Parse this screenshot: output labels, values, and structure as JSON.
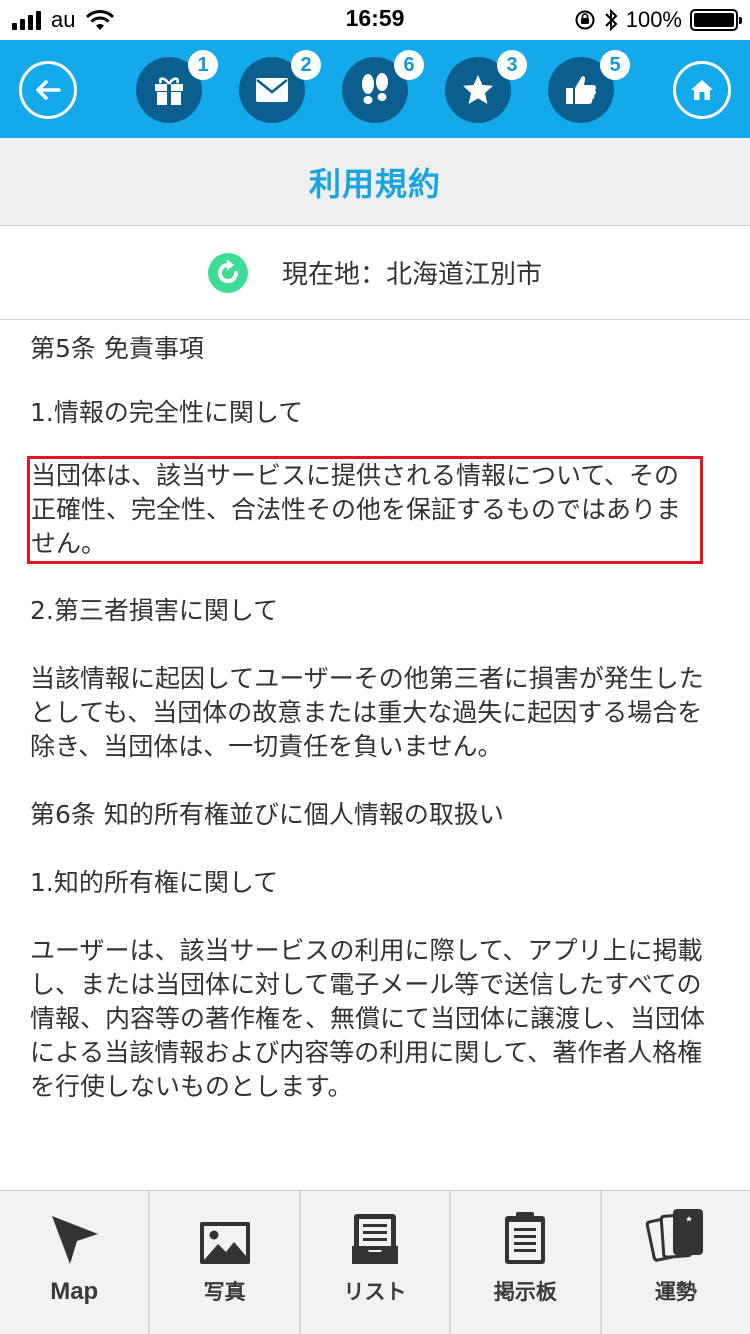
{
  "status_bar": {
    "carrier": "au",
    "time": "16:59",
    "battery": "100%"
  },
  "top_nav": {
    "items": [
      {
        "icon": "gift-icon",
        "badge": "1"
      },
      {
        "icon": "mail-icon",
        "badge": "2"
      },
      {
        "icon": "footprints-icon",
        "badge": "6"
      },
      {
        "icon": "star-icon",
        "badge": "3"
      },
      {
        "icon": "thumbs-up-icon",
        "badge": "5"
      }
    ],
    "accent_color": "#13a9ea"
  },
  "header": {
    "title": "利用規約"
  },
  "location": {
    "text": "現在地：北海道江別市"
  },
  "content": {
    "lines": [
      "第5条 免責事項",
      "1.情報の完全性に関して",
      "当団体は、該当サービスに提供される情報について、その正確性、完全性、合法性その他を保証するものではありません。",
      "2.第三者損害に関して",
      "当該情報に起因してユーザーその他第三者に損害が発生したとしても、当団体の故意または重大な過失に起因する場合を除き、当団体は、一切責任を負いません。",
      "第6条 知的所有権並びに個人情報の取扱い",
      "1.知的所有権に関して",
      "ユーザーは、該当サービスの利用に際して、アプリ上に掲載し、または当団体に対して電子メール等で送信したすべての情報、内容等の著作権を、無償にて当団体に譲渡し、当団体による当該情報および内容等の利用に関して、著作者人格権を行使しないものとします。"
    ]
  },
  "tab_bar": {
    "tabs": [
      {
        "label": "Map",
        "icon": "cursor-arrow-icon"
      },
      {
        "label": "写真",
        "icon": "photo-icon"
      },
      {
        "label": "リスト",
        "icon": "list-tray-icon"
      },
      {
        "label": "掲示板",
        "icon": "clipboard-icon"
      },
      {
        "label": "運勢",
        "icon": "fortune-cards-icon"
      }
    ]
  }
}
